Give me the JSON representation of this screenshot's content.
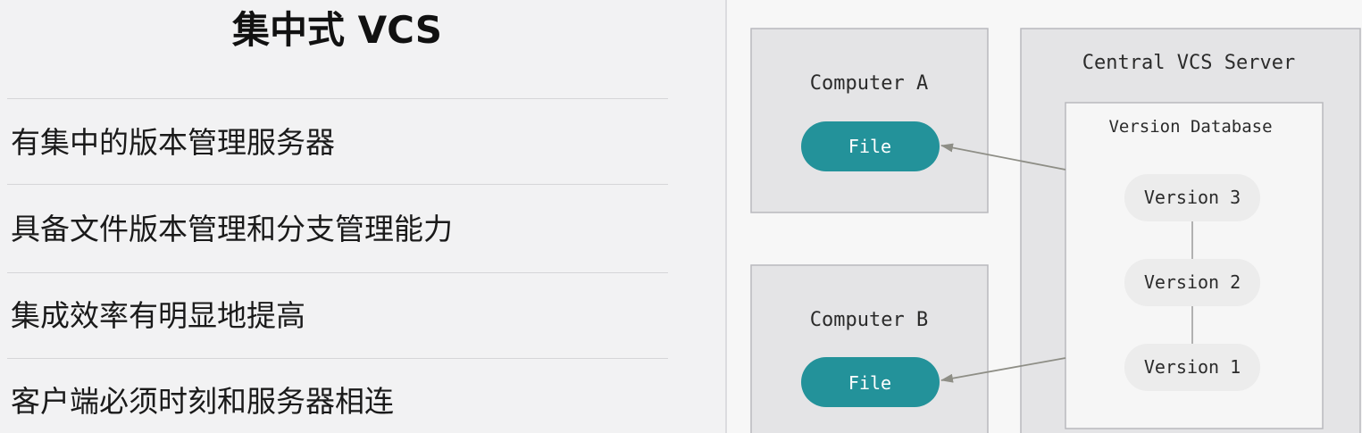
{
  "left": {
    "title": "集中式 VCS",
    "bullets": [
      "有集中的版本管理服务器",
      "具备文件版本管理和分支管理能力",
      "集成效率有明显地提高",
      "客户端必须时刻和服务器相连"
    ]
  },
  "diagram": {
    "computer_a": {
      "label": "Computer A",
      "file": "File"
    },
    "computer_b": {
      "label": "Computer B",
      "file": "File"
    },
    "server": {
      "label": "Central VCS Server",
      "database": {
        "label": "Version Database",
        "versions": [
          "Version 3",
          "Version 2",
          "Version 1"
        ]
      }
    },
    "colors": {
      "file_pill": "#23929a",
      "box_bg": "#e4e4e6",
      "db_bg": "#f6f6f6",
      "version_pill": "#ececec",
      "arrow": "#8e8e86"
    }
  }
}
